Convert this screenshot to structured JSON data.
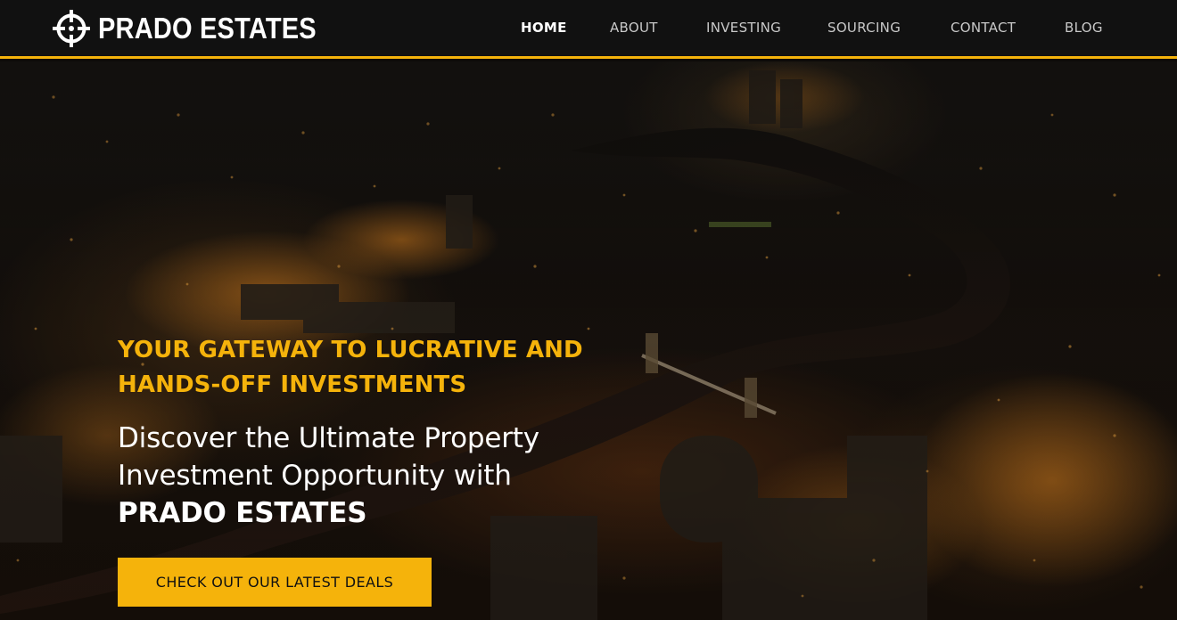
{
  "brand": {
    "name": "PRADO ESTATES",
    "logo_icon": "crosshair-target-icon"
  },
  "nav": {
    "items": [
      {
        "label": "HOME",
        "active": true
      },
      {
        "label": "ABOUT",
        "active": false
      },
      {
        "label": "INVESTING",
        "active": false
      },
      {
        "label": "SOURCING",
        "active": false
      },
      {
        "label": "CONTACT",
        "active": false
      },
      {
        "label": "BLOG",
        "active": false
      }
    ]
  },
  "hero": {
    "tagline_line1": "YOUR GATEWAY TO LUCRATIVE AND",
    "tagline_line2": "HANDS-OFF INVESTMENTS",
    "heading_line1": "Discover the Ultimate Property",
    "heading_line2": "Investment Opportunity with",
    "heading_brand": "PRADO ESTATES",
    "cta_label": "CHECK OUT OUR LATEST DEALS",
    "background": "night-city-aerial-image"
  },
  "colors": {
    "accent": "#f5b30b",
    "header_bg": "#111111",
    "text_light": "#ffffff",
    "nav_text": "#c8c8c8"
  }
}
